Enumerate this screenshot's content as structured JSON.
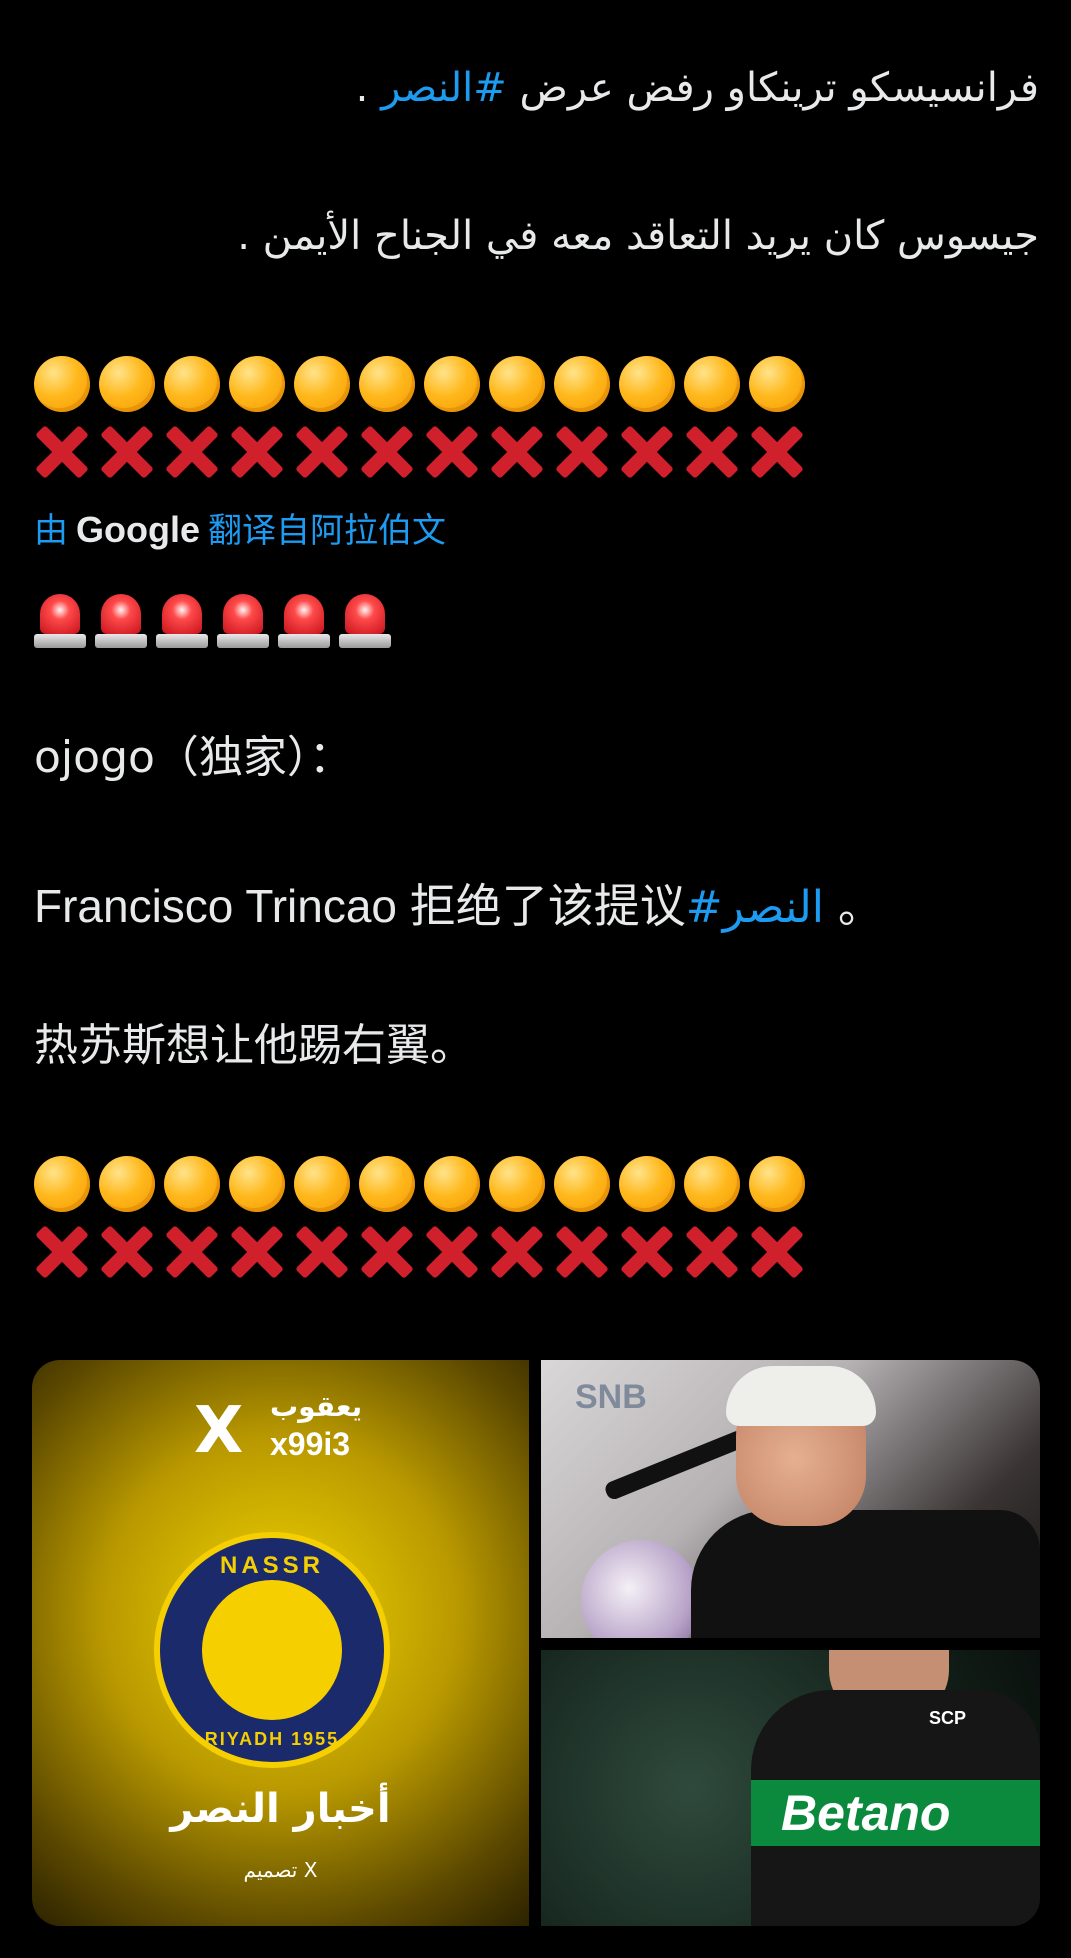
{
  "tweet": {
    "arabic_line1": "فرانسيسكو ترينكاو رفض عرض",
    "arabic_hashtag": "#النصر",
    "arabic_line1_end": ".",
    "arabic_line2": "جيسوس كان يريد التعاقد معه في الجناح الأيمن .",
    "emoji_row_count": 12,
    "siren_count": 6
  },
  "translation": {
    "by": "由",
    "google": "Google",
    "rest": "翻译自阿拉伯文"
  },
  "translated": {
    "source_line": "ojogo（独家）：",
    "line1_start": "Francisco Trincao 拒绝了该提议",
    "line1_hashtag": "#النصر",
    "line1_end": " 。",
    "line2": "热苏斯想让他踢右翼。"
  },
  "media": {
    "left_tile": {
      "brand_symbol": "X",
      "brand_arabic": "يعقوب",
      "brand_user": "x99i3",
      "crest_top": "NASSR",
      "crest_bottom": "RIYADH 1955",
      "headline": "أخبار النصر",
      "credit": "تصميم X"
    },
    "top_right_tile": {
      "backdrop_text": "SNB"
    },
    "bottom_right_tile": {
      "sponsor": "Betano",
      "badge": "SCP"
    }
  },
  "colors": {
    "background": "#000000",
    "text": "#e7e9ea",
    "accent": "#1d9bf0"
  }
}
